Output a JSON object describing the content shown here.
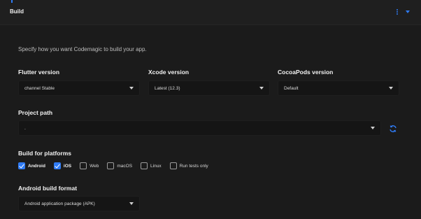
{
  "header": {
    "title": "Build"
  },
  "intro": "Specify how you want Codemagic to build your app.",
  "flutter": {
    "label": "Flutter version",
    "value": "channel Stable"
  },
  "xcode": {
    "label": "Xcode version",
    "value": "Latest (12.3)"
  },
  "cocoapods": {
    "label": "CocoaPods version",
    "value": "Default"
  },
  "project_path": {
    "label": "Project path",
    "value": "."
  },
  "platforms": {
    "label": "Build for platforms",
    "items": [
      {
        "label": "Android",
        "checked": true
      },
      {
        "label": "iOS",
        "checked": true
      },
      {
        "label": "Web",
        "checked": false
      },
      {
        "label": "macOS",
        "checked": false
      },
      {
        "label": "Linux",
        "checked": false
      },
      {
        "label": "Run tests only",
        "checked": false
      }
    ]
  },
  "android_format": {
    "label": "Android build format",
    "value": "Android application package (APK)"
  },
  "colors": {
    "accent": "#2f7bf5",
    "background": "#1b1b1b",
    "field": "#151515"
  },
  "icons": {
    "menu": "kebab-menu-icon",
    "collapse": "chevron-down-icon",
    "refresh": "refresh-icon"
  }
}
